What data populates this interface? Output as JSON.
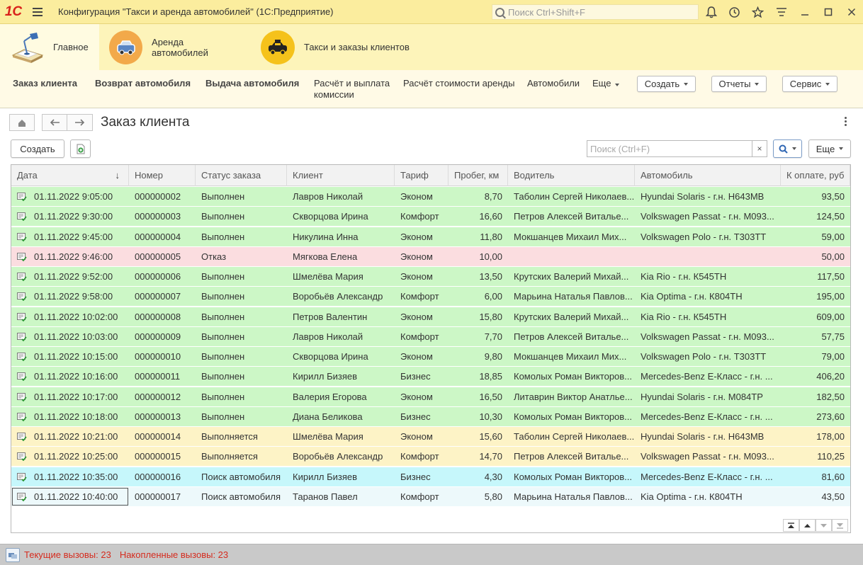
{
  "titlebar": {
    "logo": "1С",
    "title": "Конфигурация \"Такси и аренда автомобилей\"  (1С:Предприятие)",
    "search_placeholder": "Поиск Ctrl+Shift+F",
    "icons": [
      "bell-icon",
      "history-icon",
      "star-icon",
      "settings-icon",
      "minimize-icon",
      "maximize-icon",
      "close-icon"
    ]
  },
  "sections": [
    {
      "label": "Главное",
      "icon": "desk-lamp-icon",
      "active": true
    },
    {
      "label": "Аренда автомобилей",
      "icon": "car-icon",
      "active": false
    },
    {
      "label": "Такси и заказы клиентов",
      "icon": "taxi-icon",
      "active": false
    }
  ],
  "commands": {
    "items": [
      "Заказ клиента",
      "Возврат автомобиля",
      "Выдача автомобиля",
      "Расчёт и выплата",
      "комиссии",
      "Расчёт стоимости аренды",
      "Автомобили",
      "Еще"
    ],
    "buttons": [
      "Создать",
      "Отчеты",
      "Сервис"
    ]
  },
  "form": {
    "title": "Заказ клиента",
    "create_label": "Создать",
    "search_placeholder": "Поиск (Ctrl+F)",
    "clear_label": "×",
    "more_label": "Еще"
  },
  "table": {
    "columns": [
      "Дата",
      "Номер",
      "Статус заказа",
      "Клиент",
      "Тариф",
      "Пробег, км",
      "Водитель",
      "Автомобиль",
      "К оплате, руб"
    ],
    "sort_indicator": "↓",
    "colors": {
      "done": "#ccf7c6",
      "refused": "#fbdde0",
      "in_progress": "#fdf3c6",
      "searching": "#c6f7fb",
      "searching_selected": "#edf9fb"
    },
    "rows": [
      {
        "date": "01.11.2022 9:05:00",
        "number": "000000002",
        "status": "Выполнен",
        "client": "Лавров Николай",
        "tariff": "Эконом",
        "mileage": "8,70",
        "driver": "Таболин Сергей Николаев...",
        "car": "Hyundai Solaris - г.н. Н643МВ",
        "amount": "93,50",
        "state": "done"
      },
      {
        "date": "01.11.2022 9:30:00",
        "number": "000000003",
        "status": "Выполнен",
        "client": "Скворцова Ирина",
        "tariff": "Комфорт",
        "mileage": "16,60",
        "driver": "Петров Алексей Виталье...",
        "car": "Volkswagen Passat - г.н. М093...",
        "amount": "124,50",
        "state": "done"
      },
      {
        "date": "01.11.2022 9:45:00",
        "number": "000000004",
        "status": "Выполнен",
        "client": "Никулина Инна",
        "tariff": "Эконом",
        "mileage": "11,80",
        "driver": "Мокшанцев Михаил Мих...",
        "car": "Volkswagen Polo - г.н. Т303ТТ",
        "amount": "59,00",
        "state": "done"
      },
      {
        "date": "01.11.2022 9:46:00",
        "number": "000000005",
        "status": "Отказ",
        "client": "Мягкова Елена",
        "tariff": "Эконом",
        "mileage": "10,00",
        "driver": "",
        "car": "",
        "amount": "50,00",
        "state": "refused"
      },
      {
        "date": "01.11.2022 9:52:00",
        "number": "000000006",
        "status": "Выполнен",
        "client": "Шмелёва Мария",
        "tariff": "Эконом",
        "mileage": "13,50",
        "driver": "Крутских Валерий Михай...",
        "car": "Kia Rio - г.н. К545ТН",
        "amount": "117,50",
        "state": "done"
      },
      {
        "date": "01.11.2022 9:58:00",
        "number": "000000007",
        "status": "Выполнен",
        "client": "Воробьёв Александр",
        "tariff": "Комфорт",
        "mileage": "6,00",
        "driver": "Марьина Наталья Павлов...",
        "car": "Kia Optima - г.н. К804ТН",
        "amount": "195,00",
        "state": "done"
      },
      {
        "date": "01.11.2022 10:02:00",
        "number": "000000008",
        "status": "Выполнен",
        "client": "Петров Валентин",
        "tariff": "Эконом",
        "mileage": "15,80",
        "driver": "Крутских Валерий Михай...",
        "car": "Kia Rio - г.н. К545ТН",
        "amount": "609,00",
        "state": "done"
      },
      {
        "date": "01.11.2022 10:03:00",
        "number": "000000009",
        "status": "Выполнен",
        "client": "Лавров Николай",
        "tariff": "Комфорт",
        "mileage": "7,70",
        "driver": "Петров Алексей Виталье...",
        "car": "Volkswagen Passat - г.н. М093...",
        "amount": "57,75",
        "state": "done"
      },
      {
        "date": "01.11.2022 10:15:00",
        "number": "000000010",
        "status": "Выполнен",
        "client": "Скворцова Ирина",
        "tariff": "Эконом",
        "mileage": "9,80",
        "driver": "Мокшанцев Михаил Мих...",
        "car": "Volkswagen Polo - г.н. Т303ТТ",
        "amount": "79,00",
        "state": "done"
      },
      {
        "date": "01.11.2022 10:16:00",
        "number": "000000011",
        "status": "Выполнен",
        "client": "Кирилл Бизяев",
        "tariff": "Бизнес",
        "mileage": "18,85",
        "driver": "Комолых Роман Викторов...",
        "car": "Mercedes-Benz E-Класс - г.н. ...",
        "amount": "406,20",
        "state": "done"
      },
      {
        "date": "01.11.2022 10:17:00",
        "number": "000000012",
        "status": "Выполнен",
        "client": "Валерия Егорова",
        "tariff": "Эконом",
        "mileage": "16,50",
        "driver": "Литаврин Виктор Анатлье...",
        "car": "Hyundai Solaris - г.н. М084ТР",
        "amount": "182,50",
        "state": "done"
      },
      {
        "date": "01.11.2022 10:18:00",
        "number": "000000013",
        "status": "Выполнен",
        "client": "Диана Беликова",
        "tariff": "Бизнес",
        "mileage": "10,30",
        "driver": "Комолых Роман Викторов...",
        "car": "Mercedes-Benz E-Класс - г.н. ...",
        "amount": "273,60",
        "state": "done"
      },
      {
        "date": "01.11.2022 10:21:00",
        "number": "000000014",
        "status": "Выполняется",
        "client": "Шмелёва Мария",
        "tariff": "Эконом",
        "mileage": "15,60",
        "driver": "Таболин Сергей Николаев...",
        "car": "Hyundai Solaris - г.н. Н643МВ",
        "amount": "178,00",
        "state": "in_progress"
      },
      {
        "date": "01.11.2022 10:25:00",
        "number": "000000015",
        "status": "Выполняется",
        "client": "Воробьёв Александр",
        "tariff": "Комфорт",
        "mileage": "14,70",
        "driver": "Петров Алексей Виталье...",
        "car": "Volkswagen Passat - г.н. М093...",
        "amount": "110,25",
        "state": "in_progress"
      },
      {
        "date": "01.11.2022 10:35:00",
        "number": "000000016",
        "status": "Поиск автомобиля",
        "client": "Кирилл Бизяев",
        "tariff": "Бизнес",
        "mileage": "4,30",
        "driver": "Комолых Роман Викторов...",
        "car": "Mercedes-Benz E-Класс - г.н. ...",
        "amount": "81,60",
        "state": "searching"
      },
      {
        "date": "01.11.2022 10:40:00",
        "number": "000000017",
        "status": "Поиск автомобиля",
        "client": "Таранов Павел",
        "tariff": "Комфорт",
        "mileage": "5,80",
        "driver": "Марьина Наталья Павлов...",
        "car": "Kia Optima - г.н. К804ТН",
        "amount": "43,50",
        "state": "searching_selected"
      }
    ]
  },
  "statusbar": {
    "current_calls": "Текущие вызовы: 23",
    "accumulated_calls": "Накопленные вызовы: 23"
  }
}
